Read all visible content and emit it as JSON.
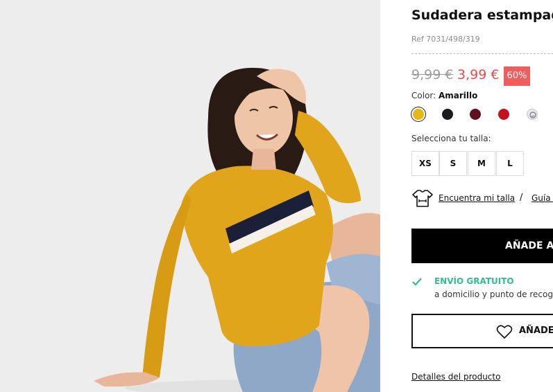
{
  "product": {
    "title": "Sudadera estampada",
    "ref": "Ref 7031/498/319",
    "old_price": "9,99 €",
    "new_price": "3,99 €",
    "discount": "60%",
    "color_label": "Color:",
    "color_value": "Amarillo",
    "colors": [
      {
        "name": "Amarillo",
        "hex": "#e8b716",
        "selected": true
      },
      {
        "name": "Negro",
        "hex": "#1c1c1c"
      },
      {
        "name": "Burdeos",
        "hex": "#5c1220"
      },
      {
        "name": "Rojo",
        "hex": "#c4121e"
      },
      {
        "name": "Estampado",
        "hex": "#d9d9e4"
      }
    ],
    "size_label": "Selecciona tu talla:",
    "sizes": [
      "XS",
      "S",
      "M",
      "L"
    ]
  },
  "fit": {
    "find_size": "Encuentra mi talla",
    "separator": "/",
    "size_guide": "Guía d"
  },
  "cart": {
    "add_label": "AÑADE A L"
  },
  "shipping": {
    "title": "ENVÍO GRATUITO",
    "subtitle": "a domicilio y punto de recogi"
  },
  "wishlist": {
    "label": "AÑADE A"
  },
  "details": {
    "label": "Detalles del producto"
  },
  "icons": {
    "shirt": "tshirt-measure-icon",
    "check": "check-icon",
    "heart": "heart-icon"
  },
  "colors_ui": {
    "accent_sale": "#f25c5c",
    "accent_shipping": "#2ebf91",
    "primary_button": "#000000"
  }
}
